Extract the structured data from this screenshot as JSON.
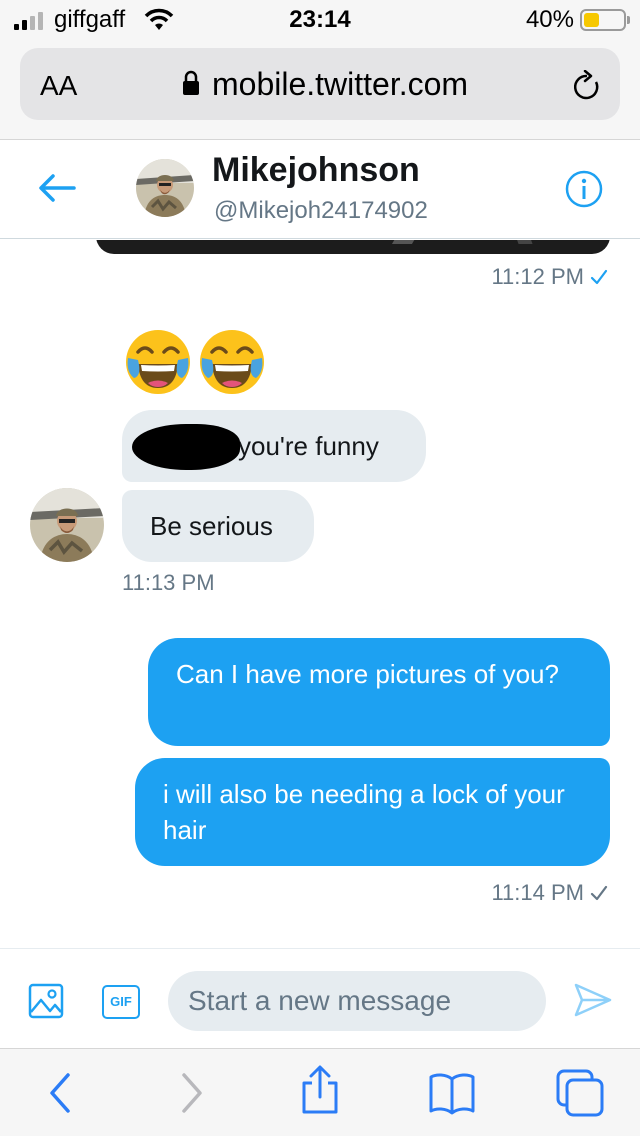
{
  "status_bar": {
    "carrier": "giffgaff",
    "time": "23:14",
    "battery": "40%",
    "battery_level": 0.4
  },
  "browser": {
    "text_size_label": "AA",
    "url": "mobile.twitter.com"
  },
  "dm_header": {
    "name": "Mikejohnson",
    "handle": "@Mikejoh24174902"
  },
  "conversation": {
    "messages": [
      {
        "time": "11:12 PM",
        "sent": true
      },
      {
        "emoji": "😂😂"
      },
      {
        "text": "you're funny",
        "redacted_prefix": true
      },
      {
        "text": "Be serious",
        "time": "11:13 PM"
      },
      {
        "text": "Can I have more pictures of you?"
      },
      {
        "text": "i will also be needing a lock of your hair",
        "time": "11:14 PM",
        "sent": true
      }
    ]
  },
  "composer": {
    "placeholder": "Start a new message",
    "gif_label": "GIF"
  },
  "colors": {
    "twitter_blue": "#1da1f2",
    "incoming_bubble": "#e6ecf0",
    "ios_blue": "#2b7cf6"
  }
}
